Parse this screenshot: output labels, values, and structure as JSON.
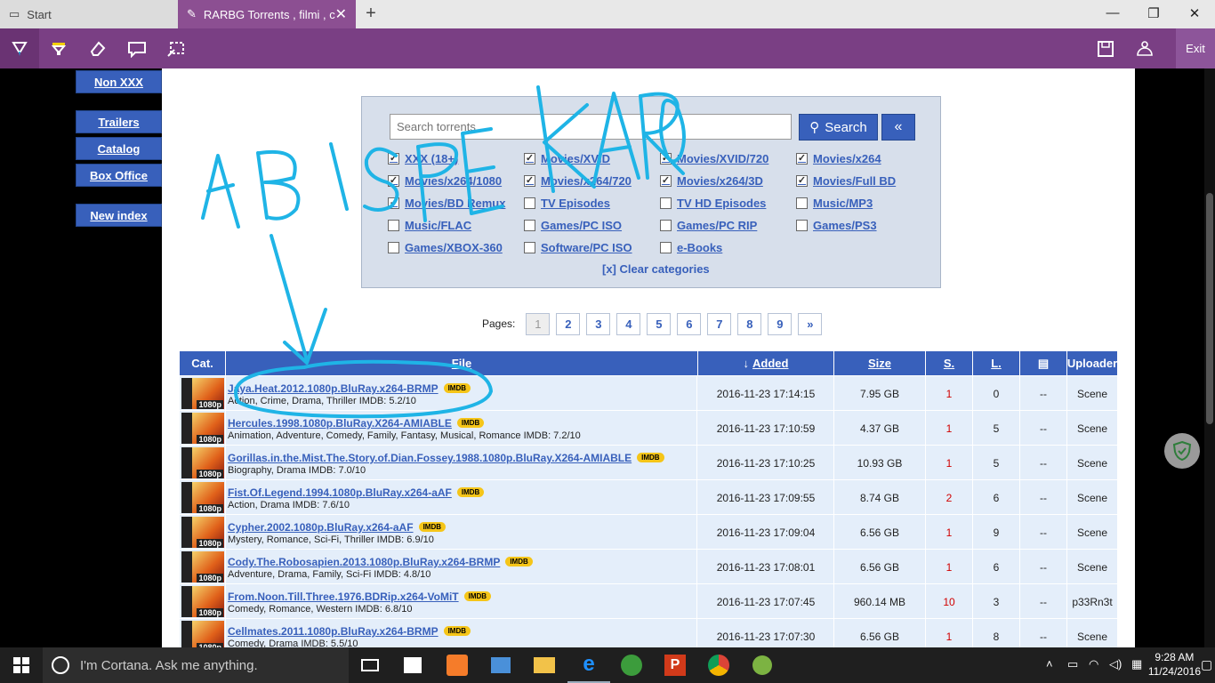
{
  "browser": {
    "tabs": [
      {
        "label": "Start"
      },
      {
        "label": "RARBG Torrents , filmi , c"
      }
    ],
    "inking": {
      "exit_label": "Exit"
    }
  },
  "sidebar": {
    "items": [
      {
        "label": "Non XXX"
      },
      {
        "label": "Trailers"
      },
      {
        "label": "Catalog"
      },
      {
        "label": "Box Office"
      },
      {
        "label": "New index"
      }
    ]
  },
  "search": {
    "placeholder": "Search torrents",
    "button_label": "Search",
    "collapse_label": "«",
    "clear_label": "[x] Clear categories",
    "categories": [
      {
        "label": "XXX (18+)",
        "checked": true
      },
      {
        "label": "Movies/XVID",
        "checked": true
      },
      {
        "label": "Movies/XVID/720",
        "checked": true
      },
      {
        "label": "Movies/x264",
        "checked": true
      },
      {
        "label": "Movies/x264/1080",
        "checked": true
      },
      {
        "label": "Movies/x264/720",
        "checked": true
      },
      {
        "label": "Movies/x264/3D",
        "checked": true
      },
      {
        "label": "Movies/Full BD",
        "checked": true
      },
      {
        "label": "Movies/BD Remux",
        "checked": true
      },
      {
        "label": "TV Episodes",
        "checked": false
      },
      {
        "label": "TV HD Episodes",
        "checked": false
      },
      {
        "label": "Music/MP3",
        "checked": false
      },
      {
        "label": "Music/FLAC",
        "checked": false
      },
      {
        "label": "Games/PC ISO",
        "checked": false
      },
      {
        "label": "Games/PC RIP",
        "checked": false
      },
      {
        "label": "Games/PS3",
        "checked": false
      },
      {
        "label": "Games/XBOX-360",
        "checked": false
      },
      {
        "label": "Software/PC ISO",
        "checked": false
      },
      {
        "label": "e-Books",
        "checked": false
      }
    ]
  },
  "pager": {
    "label": "Pages:",
    "pages": [
      "1",
      "2",
      "3",
      "4",
      "5",
      "6",
      "7",
      "8",
      "9",
      "»"
    ],
    "current": "1"
  },
  "table": {
    "headers": [
      "Cat.",
      "File",
      "Added",
      "Size",
      "S.",
      "L.",
      "",
      "Uploader"
    ],
    "imdb_badge": "IMDB",
    "thumb_badge": "1080p",
    "rows": [
      {
        "file": "Jaya.Heat.2012.1080p.BluRay.x264-BRMP",
        "genre": "Action, Crime, Drama, Thriller IMDB: 5.2/10",
        "added": "2016-11-23 17:14:15",
        "size": "7.95 GB",
        "seeders": "1",
        "leechers": "0",
        "comments": "--",
        "uploader": "Scene"
      },
      {
        "file": "Hercules.1998.1080p.BluRay.X264-AMIABLE",
        "genre": "Animation, Adventure, Comedy, Family, Fantasy, Musical, Romance IMDB: 7.2/10",
        "added": "2016-11-23 17:10:59",
        "size": "4.37 GB",
        "seeders": "1",
        "leechers": "5",
        "comments": "--",
        "uploader": "Scene"
      },
      {
        "file": "Gorillas.in.the.Mist.The.Story.of.Dian.Fossey.1988.1080p.BluRay.X264-AMIABLE",
        "genre": "Biography, Drama IMDB: 7.0/10",
        "added": "2016-11-23 17:10:25",
        "size": "10.93 GB",
        "seeders": "1",
        "leechers": "5",
        "comments": "--",
        "uploader": "Scene"
      },
      {
        "file": "Fist.Of.Legend.1994.1080p.BluRay.x264-aAF",
        "genre": "Action, Drama IMDB: 7.6/10",
        "added": "2016-11-23 17:09:55",
        "size": "8.74 GB",
        "seeders": "2",
        "leechers": "6",
        "comments": "--",
        "uploader": "Scene"
      },
      {
        "file": "Cypher.2002.1080p.BluRay.x264-aAF",
        "genre": "Mystery, Romance, Sci-Fi, Thriller IMDB: 6.9/10",
        "added": "2016-11-23 17:09:04",
        "size": "6.56 GB",
        "seeders": "1",
        "leechers": "9",
        "comments": "--",
        "uploader": "Scene"
      },
      {
        "file": "Cody.The.Robosapien.2013.1080p.BluRay.x264-BRMP",
        "genre": "Adventure, Drama, Family, Sci-Fi IMDB: 4.8/10",
        "added": "2016-11-23 17:08:01",
        "size": "6.56 GB",
        "seeders": "1",
        "leechers": "6",
        "comments": "--",
        "uploader": "Scene"
      },
      {
        "file": "From.Noon.Till.Three.1976.BDRip.x264-VoMiT",
        "genre": "Comedy, Romance, Western IMDB: 6.8/10",
        "added": "2016-11-23 17:07:45",
        "size": "960.14 MB",
        "seeders": "10",
        "leechers": "3",
        "comments": "--",
        "uploader": "p33Rn3t"
      },
      {
        "file": "Cellmates.2011.1080p.BluRay.x264-BRMP",
        "genre": "Comedy, Drama IMDB: 5.5/10",
        "added": "2016-11-23 17:07:30",
        "size": "6.56 GB",
        "seeders": "1",
        "leechers": "8",
        "comments": "--",
        "uploader": "Scene"
      }
    ]
  },
  "annotation": {
    "handwriting": "AB ISPE KARO",
    "color": "#1fb4e6"
  },
  "taskbar": {
    "cortana_placeholder": "I'm Cortana. Ask me anything.",
    "time": "9:28 AM",
    "date": "11/24/2016"
  }
}
